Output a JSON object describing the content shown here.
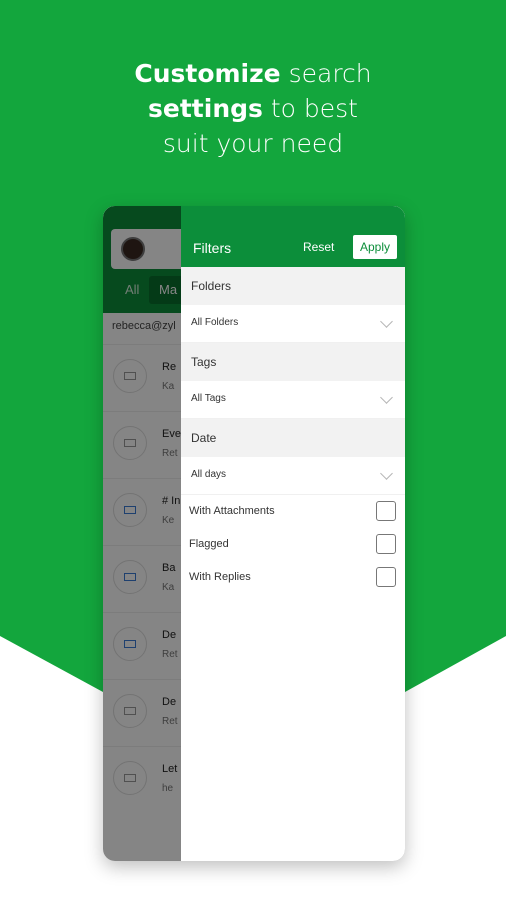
{
  "headline": {
    "line1_bold": "Customize",
    "line1_rest": " search",
    "line2_bold": "settings",
    "line2_rest": " to best",
    "line3": "suit your need"
  },
  "colors": {
    "brand_green": "#13a63d",
    "header_green": "#0c8e3a",
    "page_bg": "#ffffff"
  },
  "app": {
    "tabs": [
      "All",
      "Ma"
    ],
    "account": "rebecca@zyl",
    "mails": [
      {
        "title": "Re",
        "subtitle": "Ka",
        "icon": "envelope-icon",
        "unread": false
      },
      {
        "title": "Eve",
        "subtitle": "Ret",
        "icon": "envelope-icon",
        "unread": false
      },
      {
        "title": "# In",
        "subtitle": "Ke",
        "icon": "envelope-icon",
        "unread": true
      },
      {
        "title": "Ba",
        "subtitle": "Ka",
        "icon": "envelope-icon",
        "unread": true
      },
      {
        "title": "De",
        "subtitle": "Ret",
        "icon": "envelope-icon",
        "unread": true
      },
      {
        "title": "De",
        "subtitle": "Ret",
        "icon": "envelope-icon",
        "unread": false
      },
      {
        "title": "Let",
        "subtitle": "he",
        "icon": "envelope-icon",
        "unread": false
      }
    ]
  },
  "filters": {
    "title": "Filters",
    "reset_label": "Reset",
    "apply_label": "Apply",
    "folders": {
      "label": "Folders",
      "value": "All Folders"
    },
    "tags": {
      "label": "Tags",
      "value": "All Tags"
    },
    "date": {
      "label": "Date",
      "value": "All days"
    },
    "options": [
      {
        "label": "With Attachments",
        "checked": false
      },
      {
        "label": "Flagged",
        "checked": false
      },
      {
        "label": "With Replies",
        "checked": false
      }
    ]
  }
}
